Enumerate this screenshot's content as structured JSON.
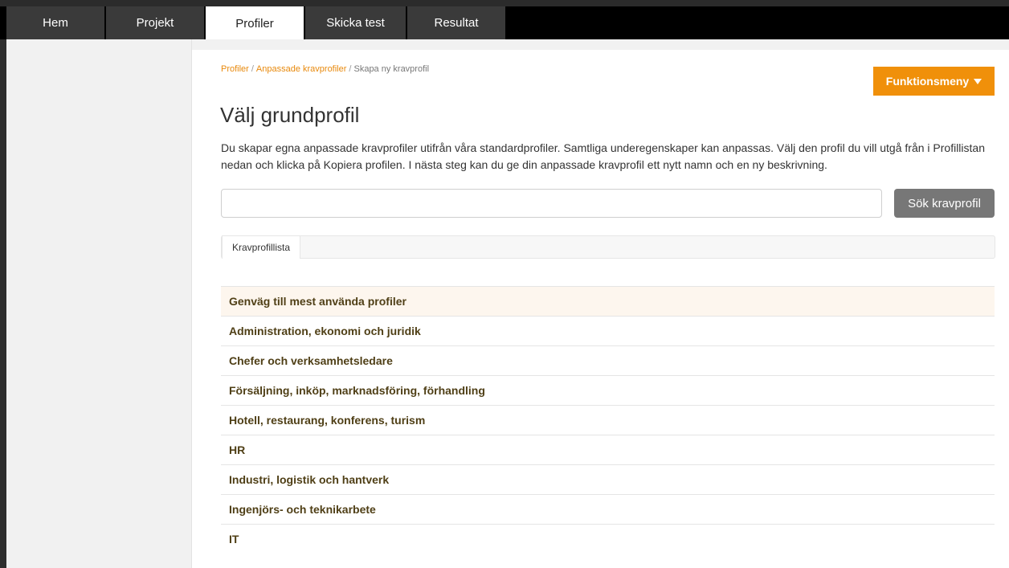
{
  "nav": {
    "tabs": [
      {
        "label": "Hem"
      },
      {
        "label": "Projekt"
      },
      {
        "label": "Profiler"
      },
      {
        "label": "Skicka test"
      },
      {
        "label": "Resultat"
      }
    ],
    "active_tab": "Profiler"
  },
  "breadcrumb": {
    "items": [
      "Profiler",
      "Anpassade kravprofiler",
      "Skapa ny kravprofil"
    ],
    "separator": "/"
  },
  "function_menu": {
    "label": "Funktionsmeny"
  },
  "page": {
    "title": "Välj grundprofil",
    "description": "Du skapar egna anpassade kravprofiler utifrån våra standardprofiler. Samtliga underegenskaper kan anpassas. Välj den profil du vill utgå från i Profillistan nedan och klicka på Kopiera profilen. I nästa steg kan du ge din anpassade kravprofil ett nytt namn och en ny beskrivning."
  },
  "search": {
    "value": "",
    "placeholder": "",
    "button_label": "Sök kravprofil"
  },
  "list_tab": {
    "label": "Kravprofillista"
  },
  "profiles": [
    "Genväg till mest använda profiler",
    "Administration, ekonomi och juridik",
    "Chefer och verksamhetsledare",
    "Försäljning, inköp, marknadsföring, förhandling",
    "Hotell, restaurang, konferens, turism",
    "HR",
    "Industri, logistik och hantverk",
    "Ingenjörs- och teknikarbete",
    "IT"
  ],
  "colors": {
    "accent": "#f0900a",
    "link": "#e8890c",
    "row_text": "#4f3f16",
    "nav_bg": "#000000"
  }
}
